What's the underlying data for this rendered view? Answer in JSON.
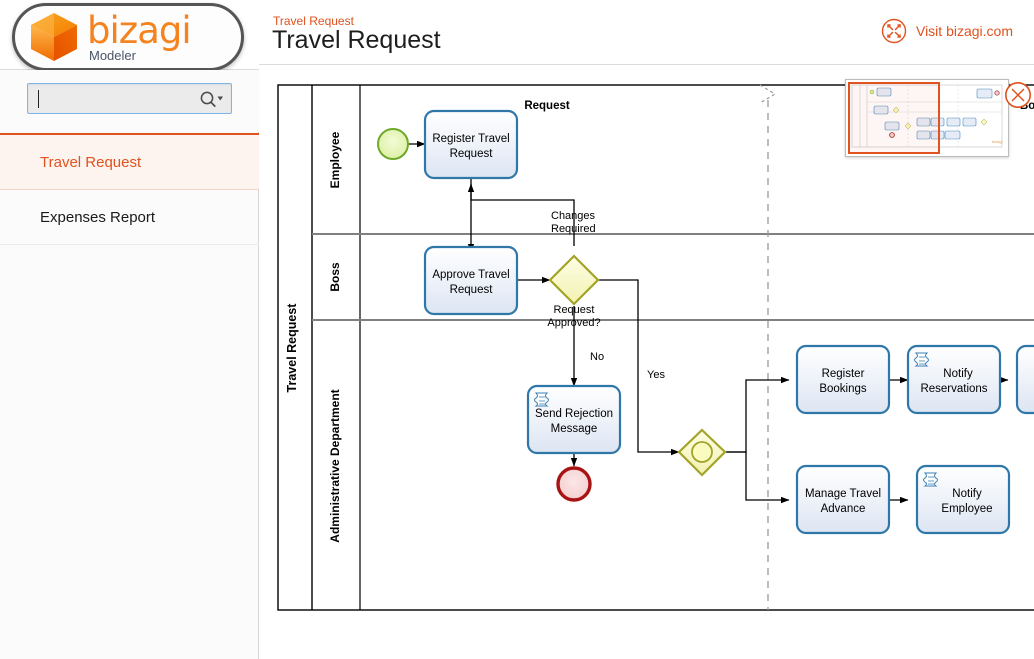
{
  "app": {
    "logo_word": "bizagi",
    "logo_sub": "Modeler",
    "brand_orange": "#e0521e",
    "logo_orange": "#f5831f"
  },
  "sidebar": {
    "search": {
      "value": "",
      "placeholder": "",
      "icon": "search-icon"
    },
    "items": [
      {
        "label": "Travel Request",
        "active": true
      },
      {
        "label": "Expenses Report",
        "active": false
      }
    ]
  },
  "header": {
    "breadcrumb": "Travel Request",
    "title": "Travel Request",
    "visit_label": "Visit bizagi.com",
    "visit_icon": "expand-icon"
  },
  "minimap": {
    "close_icon": "close-circle-icon",
    "viewport_label": "minimap-viewport"
  },
  "diagram": {
    "pool": {
      "label": "Travel Request"
    },
    "lanes": [
      {
        "id": "employee",
        "label": "Employee"
      },
      {
        "id": "boss",
        "label": "Boss"
      },
      {
        "id": "admin",
        "label": "Administrative Department"
      }
    ],
    "phases": [
      {
        "label": "Request"
      },
      {
        "label": "Bo"
      }
    ],
    "events": [
      {
        "id": "start",
        "type": "start-event",
        "label": ""
      },
      {
        "id": "end-rejected",
        "type": "end-event",
        "label": ""
      }
    ],
    "gateways": [
      {
        "id": "gw-approved",
        "type": "exclusive-gateway",
        "label": "Request Approved?"
      },
      {
        "id": "gw-parallel",
        "type": "inclusive-gateway",
        "label": ""
      }
    ],
    "tasks": [
      {
        "id": "t1",
        "label_line1": "Register Travel",
        "label_line2": "Request",
        "script": false
      },
      {
        "id": "t2",
        "label_line1": "Approve Travel",
        "label_line2": "Request",
        "script": false
      },
      {
        "id": "t3",
        "label_line1": "Send Rejection",
        "label_line2": "Message",
        "script": true
      },
      {
        "id": "t4",
        "label_line1": "Register",
        "label_line2": "Bookings",
        "script": false
      },
      {
        "id": "t5",
        "label_line1": "Notify",
        "label_line2": "Reservations",
        "script": true
      },
      {
        "id": "t6",
        "label_line1": "Manage Travel",
        "label_line2": "Advance",
        "script": false
      },
      {
        "id": "t7",
        "label_line1": "Notify",
        "label_line2": "Employee",
        "script": true
      },
      {
        "id": "t8",
        "label_line1": "",
        "label_line2": "",
        "script": false
      }
    ],
    "flow_labels": [
      {
        "id": "f-changes",
        "line1": "Changes",
        "line2": "Required"
      },
      {
        "id": "f-no",
        "line1": "No",
        "line2": ""
      },
      {
        "id": "f-yes",
        "line1": "Yes",
        "line2": ""
      }
    ],
    "colors": {
      "task_border": "#2e77a8",
      "task_fill_top": "#ffffff",
      "task_fill_bottom": "#dfe6f4",
      "start_border": "#68a81e",
      "start_fill": "#e4f5b6",
      "end_border": "#a81414",
      "end_fill": "#f7d5d5",
      "gateway_border": "#a0a020",
      "gateway_fill": "#fafbcf",
      "lane_line": "#000000",
      "phase_dash": "#9a9a9a"
    }
  }
}
